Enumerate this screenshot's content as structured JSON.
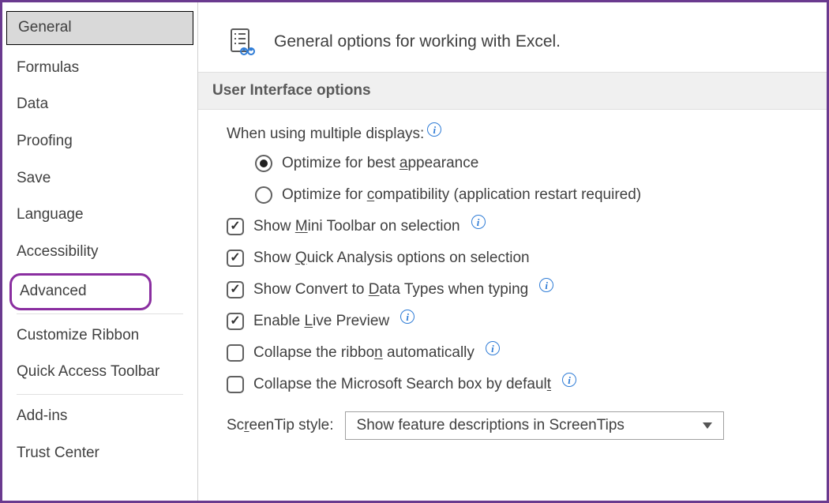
{
  "sidebar": {
    "items": [
      {
        "label": "General"
      },
      {
        "label": "Formulas"
      },
      {
        "label": "Data"
      },
      {
        "label": "Proofing"
      },
      {
        "label": "Save"
      },
      {
        "label": "Language"
      },
      {
        "label": "Accessibility"
      },
      {
        "label": "Advanced"
      },
      {
        "label": "Customize Ribbon"
      },
      {
        "label": "Quick Access Toolbar"
      },
      {
        "label": "Add-ins"
      },
      {
        "label": "Trust Center"
      }
    ]
  },
  "header": {
    "title": "General options for working with Excel."
  },
  "section": {
    "title": "User Interface options",
    "multipleDisplays": {
      "label": "When using multiple displays:",
      "optAppearancePre": "Optimize for best ",
      "optAppearanceAccel": "a",
      "optAppearancePost": "ppearance",
      "optCompatPre": "Optimize for ",
      "optCompatAccel": "c",
      "optCompatPost": "ompatibility (application restart required)"
    },
    "miniToolbar": {
      "pre": "Show ",
      "accel": "M",
      "post": "ini Toolbar on selection"
    },
    "quickAnalysis": {
      "pre": "Show ",
      "accel": "Q",
      "post": "uick Analysis options on selection"
    },
    "convertDataTypes": {
      "pre": "Show Convert to ",
      "accel": "D",
      "post": "ata Types when typing"
    },
    "livePreview": {
      "pre": "Enable ",
      "accel": "L",
      "post": "ive Preview"
    },
    "collapseRibbon": {
      "pre": "Collapse the ribbo",
      "accel": "n",
      "post": " automatically"
    },
    "collapseSearch": {
      "pre": "Collapse the Microsoft Search box by defaul",
      "accel": "t",
      "post": ""
    },
    "screenTip": {
      "labelPre": "Sc",
      "labelAccel": "r",
      "labelPost": "eenTip style:",
      "selected": "Show feature descriptions in ScreenTips"
    }
  },
  "info": "i"
}
